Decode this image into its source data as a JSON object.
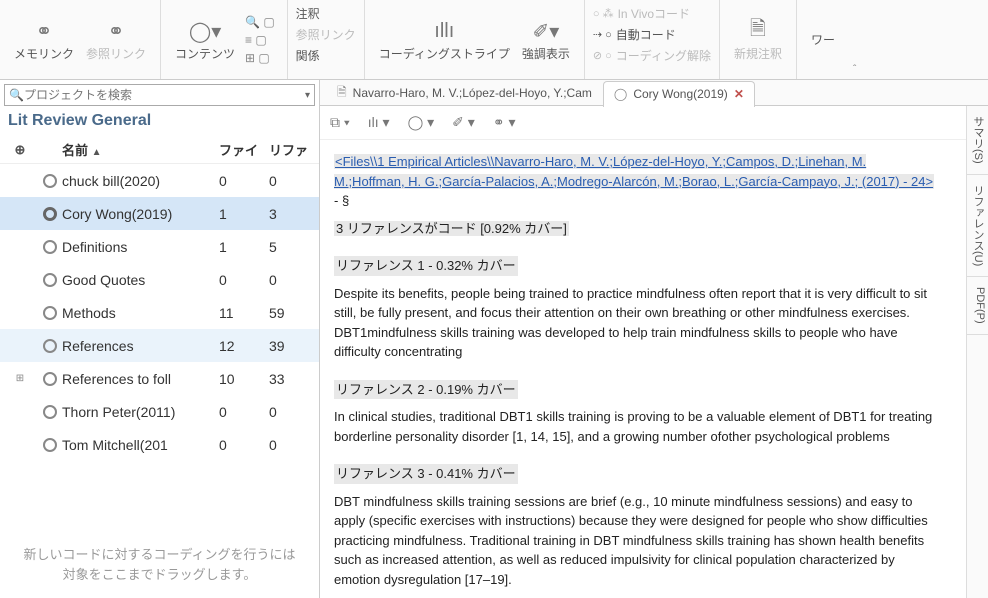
{
  "ribbon": {
    "memo_link": "メモリンク",
    "ref_link": "参照リンク",
    "contents": "コンテンツ",
    "annotation": "注釈",
    "ref_link2": "参照リンク",
    "relation": "関係",
    "coding_stripe": "コーディングストライプ",
    "highlight": "強調表示",
    "in_vivo": "In Vivoコード",
    "auto_code": "自動コード",
    "uncoding": "コーディング解除",
    "new_annotation": "新規注釈",
    "workspace": "ワー"
  },
  "search": {
    "placeholder": "プロジェクトを検索"
  },
  "lit_title": "Lit Review General",
  "columns": {
    "name": "名前",
    "file": "ファイ",
    "ref": "リファ"
  },
  "rows": [
    {
      "name": "chuck bill(2020)",
      "file": "0",
      "ref": "0",
      "expand": ""
    },
    {
      "name": "Cory Wong(2019)",
      "file": "1",
      "ref": "3",
      "expand": "",
      "selected": true
    },
    {
      "name": "Definitions",
      "file": "1",
      "ref": "5",
      "expand": ""
    },
    {
      "name": "Good Quotes",
      "file": "0",
      "ref": "0",
      "expand": ""
    },
    {
      "name": "Methods",
      "file": "11",
      "ref": "59",
      "expand": ""
    },
    {
      "name": "References",
      "file": "12",
      "ref": "39",
      "expand": "",
      "hovered": true
    },
    {
      "name": "References to foll",
      "file": "10",
      "ref": "33",
      "expand": "+"
    },
    {
      "name": "Thorn Peter(2011)",
      "file": "0",
      "ref": "0",
      "expand": ""
    },
    {
      "name": "Tom Mitchell(201",
      "file": "0",
      "ref": "0",
      "expand": ""
    }
  ],
  "drop_hint_l1": "新しいコードに対するコーディングを行うには",
  "drop_hint_l2": "対象をここまでドラッグします。",
  "tabs": [
    {
      "label": "Navarro-Haro, M. V.;López-del-Hoyo, Y.;Cam",
      "active": false
    },
    {
      "label": "Cory Wong(2019)",
      "active": true
    }
  ],
  "doc": {
    "file_link": "<Files\\\\1 Empirical Articles\\\\Navarro-Haro, M. V.;López-del-Hoyo, Y.;Campos, D.;Linehan, M. M.;Hoffman, H. G.;García-Palacios, A.;Modrego-Alarcón, M.;Borao, L.;García-Campayo, J.; (2017) - 24>",
    "after_link": " - §",
    "summary": "3 リファレンスがコード  [0.92% カバー]",
    "ref1_head": "リファレンス 1 - 0.32% カバー",
    "ref1_body": "Despite its benefits, people being trained to practice mindfulness often report that it is very difficult to sit still, be fully present, and focus their attention on their own breathing or other mindfulness exercises. DBT1mindfulness skills training was developed to help train mindfulness skills to people who have difficulty concentrating",
    "ref2_head": "リファレンス 2 - 0.19% カバー",
    "ref2_body": "In clinical studies, traditional DBT1 skills training is proving to be a valuable element of DBT1 for treating borderline personality disorder [1, 14, 15], and a growing number ofother psychological problems",
    "ref3_head": "リファレンス 3 - 0.41% カバー",
    "ref3_body": "DBT mindfulness skills training sessions are brief (e.g., 10 minute mindfulness sessions) and easy to apply (specific exercises with instructions) because they were designed for people who show difficulties practicing mindfulness. Traditional training in DBT mindfulness skills training has shown health benefits such as increased attention, as well as reduced impulsivity for clinical population characterized by emotion dysregulation [17–19]."
  },
  "side": {
    "summary": "サマリ(S)",
    "reference": "リファレンス(U)",
    "pdf": "PDF(P)"
  }
}
